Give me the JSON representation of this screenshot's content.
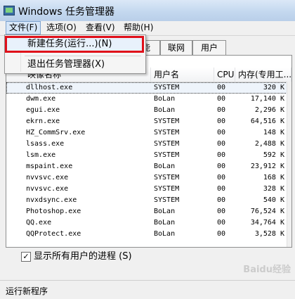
{
  "window": {
    "title": "Windows 任务管理器"
  },
  "menu": [
    {
      "label": "文件(F)"
    },
    {
      "label": "选项(O)"
    },
    {
      "label": "查看(V)"
    },
    {
      "label": "帮助(H)"
    }
  ],
  "file_menu": {
    "items": [
      {
        "label": "新建任务(运行...)(N)"
      },
      {
        "label": "退出任务管理器(X)"
      }
    ]
  },
  "tabs": [
    {
      "label": "能"
    },
    {
      "label": "联网"
    },
    {
      "label": "用户"
    }
  ],
  "table": {
    "columns": [
      "映像名称",
      "用户名",
      "CPU",
      "内存(专用工..."
    ],
    "rows": [
      {
        "name": "dllhost.exe",
        "user": "SYSTEM",
        "cpu": "00",
        "mem": "320 K"
      },
      {
        "name": "dwm.exe",
        "user": "BoLan",
        "cpu": "00",
        "mem": "17,140 K"
      },
      {
        "name": "egui.exe",
        "user": "BoLan",
        "cpu": "00",
        "mem": "2,296 K"
      },
      {
        "name": "ekrn.exe",
        "user": "SYSTEM",
        "cpu": "00",
        "mem": "64,516 K"
      },
      {
        "name": "HZ_CommSrv.exe",
        "user": "SYSTEM",
        "cpu": "00",
        "mem": "148 K"
      },
      {
        "name": "lsass.exe",
        "user": "SYSTEM",
        "cpu": "00",
        "mem": "2,488 K"
      },
      {
        "name": "lsm.exe",
        "user": "SYSTEM",
        "cpu": "00",
        "mem": "592 K"
      },
      {
        "name": "mspaint.exe",
        "user": "BoLan",
        "cpu": "00",
        "mem": "23,912 K"
      },
      {
        "name": "nvvsvc.exe",
        "user": "SYSTEM",
        "cpu": "00",
        "mem": "168 K"
      },
      {
        "name": "nvvsvc.exe",
        "user": "SYSTEM",
        "cpu": "00",
        "mem": "328 K"
      },
      {
        "name": "nvxdsync.exe",
        "user": "SYSTEM",
        "cpu": "00",
        "mem": "540 K"
      },
      {
        "name": "Photoshop.exe",
        "user": "BoLan",
        "cpu": "00",
        "mem": "76,524 K"
      },
      {
        "name": "QQ.exe",
        "user": "BoLan",
        "cpu": "00",
        "mem": "34,764 K"
      },
      {
        "name": "QQProtect.exe",
        "user": "BoLan",
        "cpu": "00",
        "mem": "3,528 K"
      }
    ]
  },
  "show_all_users": {
    "label": "显示所有用户的进程 (S)",
    "checked": "✓"
  },
  "status_bar": {
    "text": "运行新程序"
  },
  "watermark": {
    "text": "Baidu经验"
  }
}
